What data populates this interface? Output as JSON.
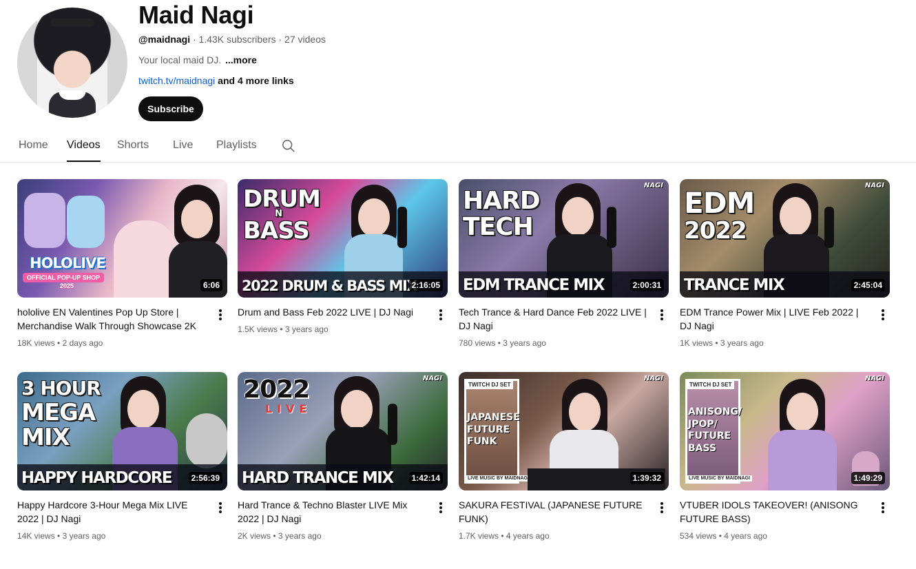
{
  "channel": {
    "name": "Maid Nagi",
    "handle": "@maidnagi",
    "stats": " · 1.43K subscribers · 27 videos",
    "description": "Your local maid DJ.",
    "more_label": "...more",
    "link": "twitch.tv/maidnagi",
    "more_links": " and 4 more links",
    "subscribe_label": "Subscribe"
  },
  "tabs": [
    {
      "label": "Home",
      "active": false
    },
    {
      "label": "Videos",
      "active": true
    },
    {
      "label": "Shorts",
      "active": false
    },
    {
      "label": "Live",
      "active": false
    },
    {
      "label": "Playlists",
      "active": false
    }
  ],
  "videos": [
    {
      "title": "hololive EN Valentines Pop Up Store | Merchandise Walk Through Showcase 2K",
      "views": "18K views",
      "age": "2 days ago",
      "duration": "6:06",
      "thumb_text": [
        "HOLOLIVE",
        "OFFICIAL POP-UP SHOP",
        "2025"
      ]
    },
    {
      "title": "Drum and Bass Feb 2022 LIVE | DJ Nagi",
      "views": "1.5K views",
      "age": "3 years ago",
      "duration": "2:16:05",
      "thumb_text": [
        "DRUM",
        "N",
        "BASS",
        "2022 DRUM & BASS MIX"
      ]
    },
    {
      "title": "Tech Trance & Hard Dance Feb 2022 LIVE | DJ Nagi",
      "views": "780 views",
      "age": "3 years ago",
      "duration": "2:00:31",
      "thumb_text": [
        "HARD",
        "TECH",
        "EDM TRANCE MIX"
      ]
    },
    {
      "title": "EDM Trance Power Mix | LIVE Feb 2022 | DJ Nagi",
      "views": "1K views",
      "age": "3 years ago",
      "duration": "2:45:04",
      "thumb_text": [
        "EDM",
        "2022",
        "TRANCE MIX"
      ]
    },
    {
      "title": "Happy Hardcore 3-Hour Mega Mix LIVE 2022 | DJ Nagi",
      "views": "14K views",
      "age": "3 years ago",
      "duration": "2:56:39",
      "thumb_text": [
        "3 HOUR",
        "MEGA",
        "MIX",
        "HAPPY HARDCORE"
      ]
    },
    {
      "title": "Hard Trance & Techno Blaster LIVE Mix 2022 | DJ Nagi",
      "views": "2K views",
      "age": "3 years ago",
      "duration": "1:42:14",
      "thumb_text": [
        "2022",
        "LIVE",
        "HARD TRANCE MIX"
      ]
    },
    {
      "title": "SAKURA FESTIVAL (JAPANESE FUTURE FUNK)",
      "views": "1.7K views",
      "age": "4 years ago",
      "duration": "1:39:32",
      "thumb_text": [
        "TWITCH DJ SET",
        "JAPANESE FUTURE FUNK",
        "LIVE MUSIC BY MAIDNAGI"
      ]
    },
    {
      "title": "VTUBER IDOLS TAKEOVER! (ANISONG FUTURE BASS)",
      "views": "534 views",
      "age": "4 years ago",
      "duration": "1:49:29",
      "thumb_text": [
        "TWITCH DJ SET",
        "ANISONG/ JPOP/ FUTURE BASS",
        "LIVE MUSIC BY MAIDNAGI"
      ]
    }
  ],
  "thumb_logo": "NAGI",
  "colors": {
    "text_primary": "#0f0f0f",
    "text_secondary": "#606060",
    "link": "#065fd4",
    "subscribe_bg": "#0f0f0f"
  }
}
